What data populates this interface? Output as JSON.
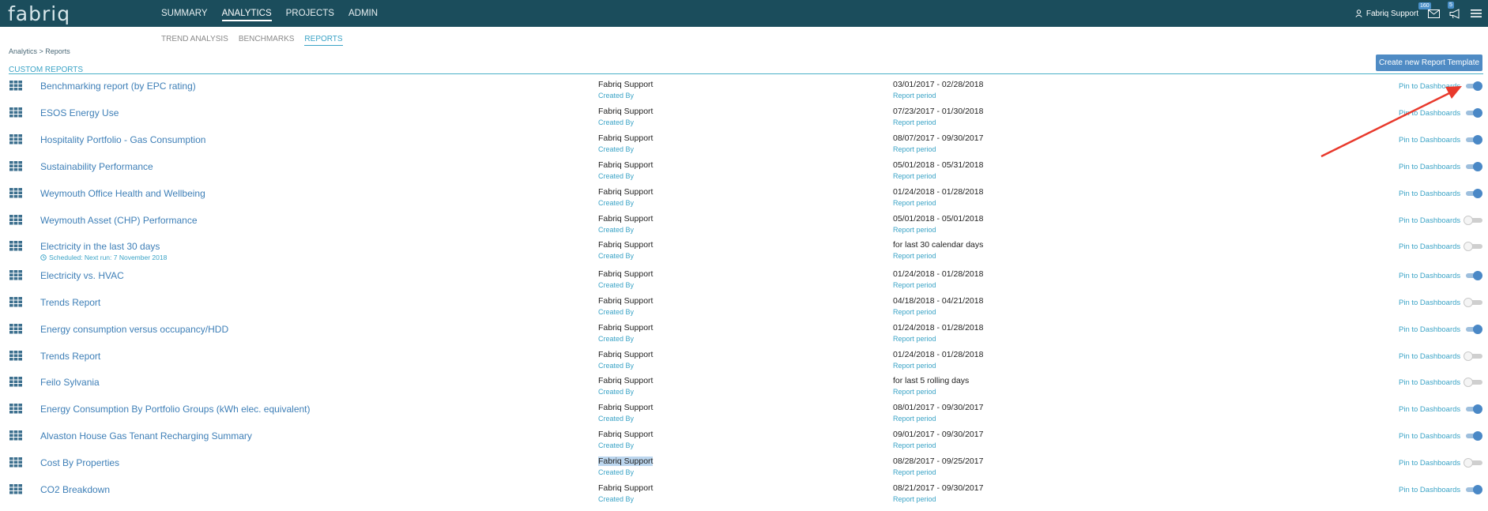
{
  "app": {
    "logo": "fabriq"
  },
  "topnav": {
    "items": [
      {
        "label": "SUMMARY",
        "active": false
      },
      {
        "label": "ANALYTICS",
        "active": true
      },
      {
        "label": "PROJECTS",
        "active": false
      },
      {
        "label": "ADMIN",
        "active": false
      }
    ],
    "user_name": "Fabriq Support",
    "messages_badge": "160",
    "announcements_badge": "5"
  },
  "subnav": {
    "items": [
      {
        "label": "TREND ANALYSIS",
        "active": false
      },
      {
        "label": "BENCHMARKS",
        "active": false
      },
      {
        "label": "REPORTS",
        "active": true
      }
    ]
  },
  "breadcrumb": {
    "parent": "Analytics",
    "separator": " > ",
    "current": "Reports"
  },
  "section_title": "CUSTOM REPORTS",
  "create_button": "Create new Report Template",
  "labels": {
    "created_by": "Created By",
    "report_period": "Report period",
    "pin": "Pin to Dashboards"
  },
  "reports": [
    {
      "name": "Benchmarking report (by EPC rating)",
      "creator": "Fabriq Support",
      "period": "03/01/2017 - 02/28/2018",
      "pinned": true
    },
    {
      "name": "ESOS Energy Use",
      "creator": "Fabriq Support",
      "period": "07/23/2017 - 01/30/2018",
      "pinned": true
    },
    {
      "name": "Hospitality Portfolio - Gas Consumption",
      "creator": "Fabriq Support",
      "period": "08/07/2017 - 09/30/2017",
      "pinned": true
    },
    {
      "name": "Sustainability Performance",
      "creator": "Fabriq Support",
      "period": "05/01/2018 - 05/31/2018",
      "pinned": true
    },
    {
      "name": "Weymouth Office Health and Wellbeing",
      "creator": "Fabriq Support",
      "period": "01/24/2018 - 01/28/2018",
      "pinned": true
    },
    {
      "name": "Weymouth Asset (CHP) Performance",
      "creator": "Fabriq Support",
      "period": "05/01/2018 - 05/01/2018",
      "pinned": false
    },
    {
      "name": "Electricity in the last 30 days",
      "schedule": "Scheduled: Next run: 7 November 2018",
      "creator": "Fabriq Support",
      "period": "for last 30 calendar days",
      "pinned": false
    },
    {
      "name": "Electricity vs. HVAC",
      "creator": "Fabriq Support",
      "period": "01/24/2018 - 01/28/2018",
      "pinned": true
    },
    {
      "name": "Trends Report",
      "creator": "Fabriq Support",
      "period": "04/18/2018 - 04/21/2018",
      "pinned": false
    },
    {
      "name": "Energy consumption versus occupancy/HDD",
      "creator": "Fabriq Support",
      "period": "01/24/2018 - 01/28/2018",
      "pinned": true
    },
    {
      "name": "Trends Report",
      "creator": "Fabriq Support",
      "period": "01/24/2018 - 01/28/2018",
      "pinned": false
    },
    {
      "name": "Feilo Sylvania",
      "creator": "Fabriq Support",
      "period": "for last 5 rolling days",
      "pinned": false
    },
    {
      "name": "Energy Consumption By Portfolio Groups (kWh elec. equivalent)",
      "creator": "Fabriq Support",
      "period": "08/01/2017 - 09/30/2017",
      "pinned": true
    },
    {
      "name": "Alvaston House Gas Tenant Recharging Summary",
      "creator": "Fabriq Support",
      "period": "09/01/2017 - 09/30/2017",
      "pinned": true
    },
    {
      "name": "Cost By Properties",
      "creator": "Fabriq Support",
      "creator_selected": true,
      "period": "08/28/2017 - 09/25/2017",
      "pinned": false
    },
    {
      "name": "CO2 Breakdown",
      "creator": "Fabriq Support",
      "period": "08/21/2017 - 09/30/2017",
      "pinned": true
    }
  ],
  "colors": {
    "topbar": "#1b4d5c",
    "accent": "#3aa3c6",
    "link": "#3e7fb7",
    "toggle_on": "#4a88c6",
    "annotation_arrow": "#e8392c"
  }
}
